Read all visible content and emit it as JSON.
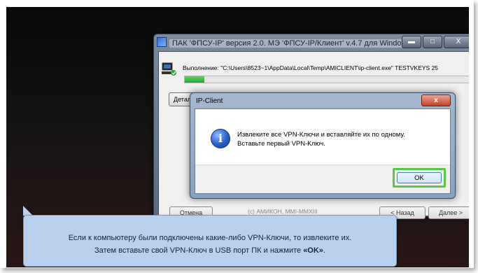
{
  "installer": {
    "title": "ПАК 'ФПСУ-IP' версия 2.0. МЭ 'ФПСУ-IP/Клиент' v.4.7 для Windows",
    "exec_text": "Выполнение: \"C:\\Users\\8523~1\\AppData\\Local\\Temp\\AMICLIENT\\ip-client.exe\" TESTVKEYS 25",
    "progress_percent": 7,
    "details_label": "Детали...",
    "cancel_label": "Отмена",
    "copyright": "(c) АМИКОН, MMI-MMXIII",
    "back_label": "< Назад",
    "next_label": "Далее >",
    "minimize_glyph": "▬",
    "maximize_glyph": "□",
    "close_glyph": "X"
  },
  "dialog": {
    "title": "IP-Client",
    "close_glyph": "x",
    "icon": "info-icon",
    "message_line1": "Извлеките все VPN-Ключи и вставляйте их по одному.",
    "message_line2": "Вставьте первый VPN-Ключ.",
    "ok_label": "OK"
  },
  "callout": {
    "line1": "Если к компьютеру были подключены какие-либо VPN-Ключи, то извлеките их.",
    "line2_prefix": "Затем вставьте свой VPN-Ключ в USB порт ПК и нажмите ",
    "line2_bold": "«OK»",
    "line2_suffix": ".",
    "highlight_color": "#5ec64a"
  }
}
